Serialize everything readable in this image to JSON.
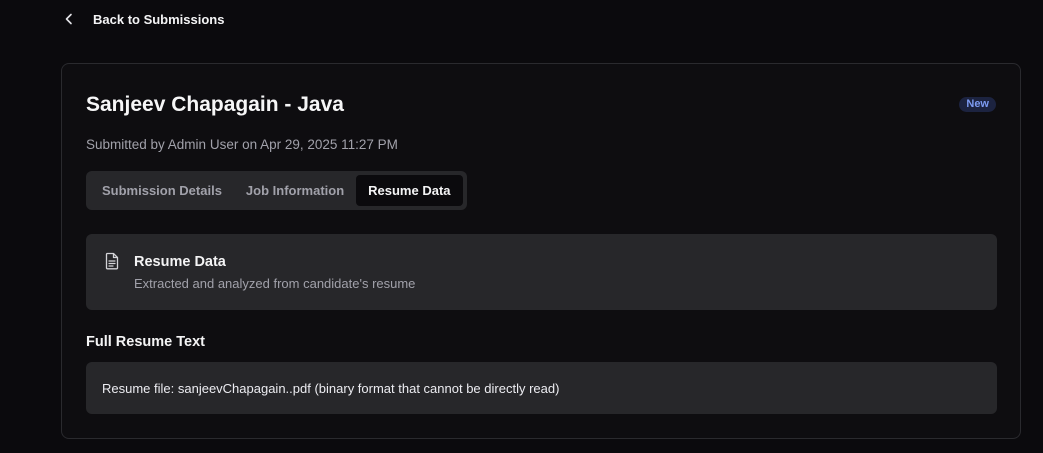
{
  "nav": {
    "back_label": "Back to Submissions",
    "back_icon": "chevron-left-icon"
  },
  "submission": {
    "title": "Sanjeev Chapagain - Java",
    "status_badge": "New",
    "subtitle": "Submitted by Admin User on Apr 29, 2025 11:27 PM"
  },
  "tabs": [
    {
      "label": "Submission Details",
      "active": false
    },
    {
      "label": "Job Information",
      "active": false
    },
    {
      "label": "Resume Data",
      "active": true
    }
  ],
  "resume_panel": {
    "icon": "file-text-icon",
    "title": "Resume Data",
    "description": "Extracted and analyzed from candidate's resume"
  },
  "full_resume": {
    "heading": "Full Resume Text",
    "text": "Resume file: sanjeevChapagain..pdf (binary format that cannot be directly read)"
  },
  "colors": {
    "background": "#0b0a0d",
    "surface": "#27272a",
    "badge_bg": "#1c2340",
    "badge_text": "#7d9bf2",
    "muted_text": "#a1a1aa"
  }
}
